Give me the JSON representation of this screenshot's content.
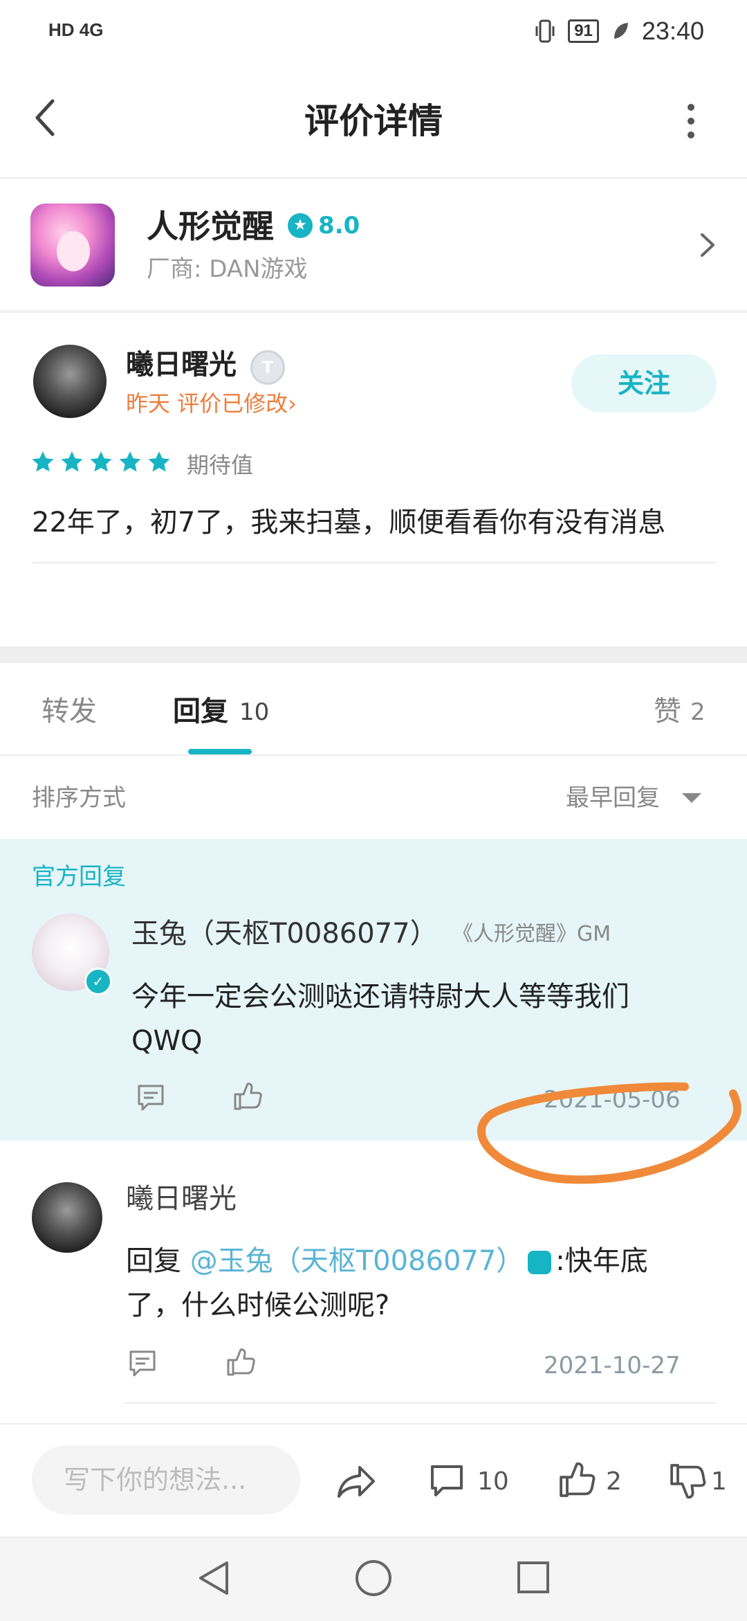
{
  "status_bar": {
    "network": "HD 4G",
    "battery": "91",
    "time": "23:40"
  },
  "header": {
    "title": "评价详情"
  },
  "game": {
    "name": "人形觉醒",
    "score": "8.0",
    "vendor": "厂商:  DAN游戏"
  },
  "review": {
    "author": "曦日曙光",
    "level": "T",
    "meta": "昨天 评价已修改›",
    "follow_label": "关注",
    "stars_label": "期待值",
    "text": "22年了，初7了，我来扫墓，顺便看看你有没有消息"
  },
  "tabs": {
    "forward": "转发",
    "reply": "回复",
    "reply_count": "10",
    "like": "赞",
    "like_count": "2"
  },
  "sort": {
    "label": "排序方式",
    "value": "最早回复"
  },
  "official_reply": {
    "label": "官方回复",
    "author": "玉兔（天枢T0086077）",
    "tag": "《人形觉醒》GM",
    "text": "今年一定会公测哒还请特尉大人等等我们QWQ",
    "date": "2021-05-06"
  },
  "user_reply": {
    "author": "曦日曙光",
    "prefix": "回复 ",
    "mention": "@玉兔（天枢T0086077）",
    "text": ":快年底了，什么时候公测呢?",
    "date": "2021-10-27"
  },
  "bottom_bar": {
    "placeholder": "写下你的想法...",
    "comment_count": "10",
    "like_count": "2",
    "dislike_count": "1"
  },
  "colors": {
    "accent": "#17b4c4",
    "orange": "#ee7d3c",
    "annotation": "#f08a3a"
  }
}
